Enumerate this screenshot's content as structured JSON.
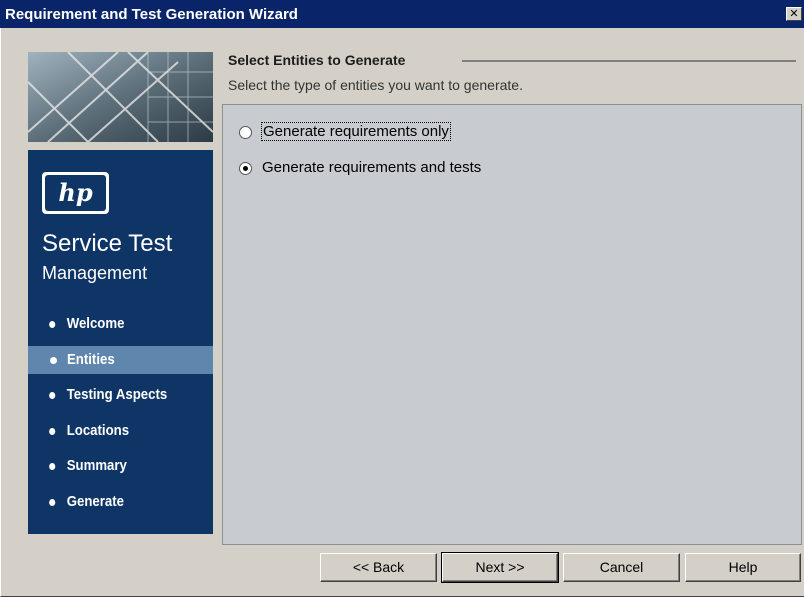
{
  "window": {
    "title": "Requirement and Test Generation Wizard",
    "close_glyph": "✕"
  },
  "sidebar": {
    "logo_text": "hp",
    "product_name": "Service Test",
    "product_subtitle": "Management",
    "steps": [
      {
        "label": "Welcome",
        "active": false
      },
      {
        "label": "Entities",
        "active": true
      },
      {
        "label": "Testing Aspects",
        "active": false
      },
      {
        "label": "Locations",
        "active": false
      },
      {
        "label": "Summary",
        "active": false
      },
      {
        "label": "Generate",
        "active": false
      }
    ]
  },
  "header": {
    "title": "Select Entities to Generate",
    "subtitle": "Select the type of entities you want to generate."
  },
  "options": [
    {
      "label": "Generate requirements only",
      "checked": false,
      "focused": true
    },
    {
      "label": "Generate requirements and tests",
      "checked": true,
      "focused": false
    }
  ],
  "buttons": {
    "back": "<< Back",
    "next": "Next >>",
    "cancel": "Cancel",
    "help": "Help"
  },
  "colors": {
    "titlebar": "#0a246a",
    "sidebar_bg": "#0f3567",
    "active_step": "#5f86ad",
    "panel_bg": "#c8ccd0"
  }
}
